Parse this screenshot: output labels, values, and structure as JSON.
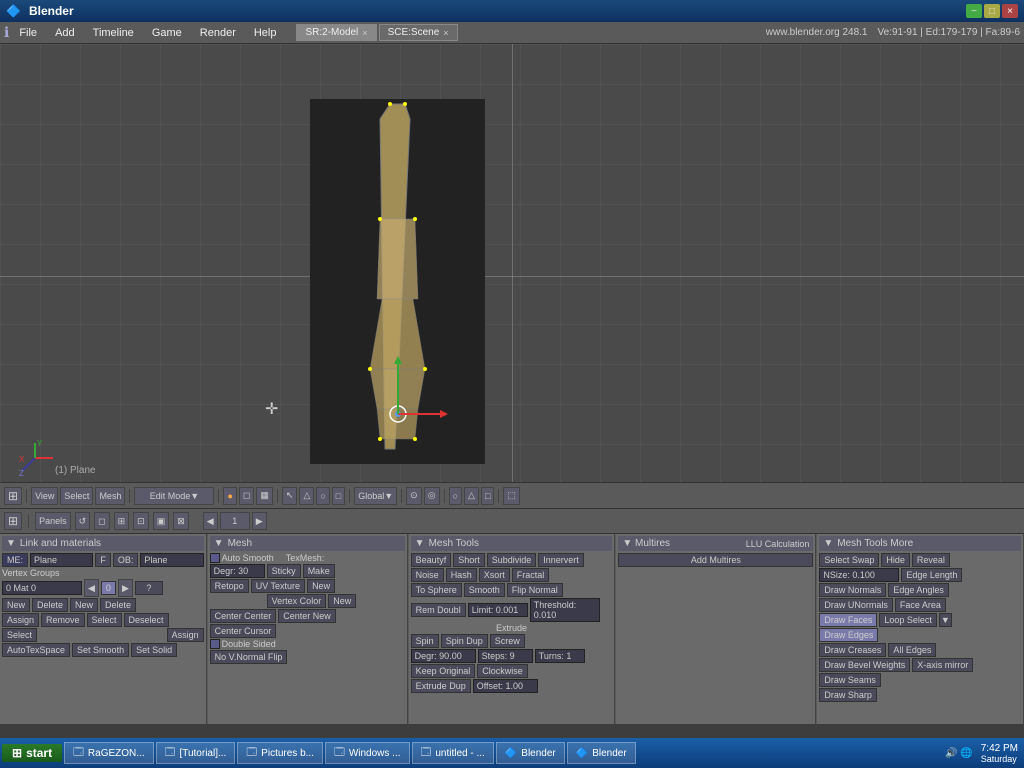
{
  "titlebar": {
    "title": "Blender",
    "min": "−",
    "max": "□",
    "close": "×"
  },
  "menubar": {
    "items": [
      "File",
      "Add",
      "Timeline",
      "Game",
      "Render",
      "Help"
    ],
    "tabs": [
      {
        "label": "SR:2-Model",
        "active": true
      },
      {
        "label": "SCE:Scene",
        "active": false
      }
    ],
    "website": "www.blender.org 248.1",
    "info": "Ve:91-91 | Ed:179-179 | Fa:89-6"
  },
  "viewport_toolbar": {
    "mode": "Edit Mode",
    "select_mode": "Global",
    "items": [
      "View",
      "Select",
      "Mesh"
    ]
  },
  "panels_toolbar": {
    "label": "Panels",
    "page": "1"
  },
  "object_label": "(1) Plane",
  "panel_link": {
    "header": "Link and materials",
    "me_label": "ME:",
    "me_value": "Plane",
    "f_label": "F",
    "ob_label": "OB:",
    "ob_value": "Plane",
    "vertex_groups": "Vertex Groups",
    "mat0": "0 Mat 0",
    "buttons": {
      "new": "New",
      "delete": "Delete",
      "assign": "Assign",
      "remove": "Remove",
      "select": "Select",
      "deselect": "Deselect",
      "set_smooth": "Set Smooth",
      "set_solid": "Set Solid",
      "autotexspace": "AutoTexSpace"
    }
  },
  "panel_mesh": {
    "header": "Mesh",
    "auto_smooth": "Auto Smooth",
    "degr": "Degr: 30",
    "retopo": "Retopo",
    "tex_mesh": "TexMesh:",
    "sticky": "Sticky",
    "uv_texture": "UV Texture",
    "vertex_color": "Vertex Color",
    "make": "Make",
    "new": "New",
    "center_center": "Center Center",
    "center_new": "Center New",
    "center_cursor": "Center Cursor",
    "double_sided": "Double Sided",
    "no_v_normal_flip": "No V.Normal Flip"
  },
  "panel_mesh_tools": {
    "header": "Mesh Tools",
    "buttons": {
      "beauty": "Beautyf",
      "short": "Short",
      "subdivide": "Subdivide",
      "innervert": "Innervert",
      "noise": "Noise",
      "hash": "Hash",
      "xsort": "Xsort",
      "fractal": "Fractal",
      "to_sphere": "To Sphere",
      "smooth": "Smooth",
      "flip_normal": "Flip Normal",
      "rem_doubl": "Rem Doubl",
      "limit": "Limit: 0.001",
      "threshold": "Threshold: 0.010",
      "extrude": "Extrude",
      "spin": "Spin",
      "spin_dup": "Spin Dup",
      "screw": "Screw",
      "degr": "Degr: 90.00",
      "steps": "Steps: 9",
      "turns": "Turns: 1",
      "keep_original": "Keep Original",
      "clockwise": "Clockwise",
      "extrude_dup": "Extrude Dup",
      "offset": "Offset: 1.00"
    }
  },
  "panel_multires": {
    "header": "Multires",
    "llu_calc": "LLU Calculation",
    "add_multires": "Add Multires"
  },
  "panel_mesh_tools_more": {
    "header": "Mesh Tools More",
    "buttons": {
      "select_swap": "Select Swap",
      "hide": "Hide",
      "reveal": "Reveal",
      "nsize": "NSize: 0.100",
      "edge_length": "Edge Length",
      "draw_normals": "Draw Normals",
      "edge_angles": "Edge Angles",
      "draw_unormals": "Draw UNormals",
      "face_area": "Face Area",
      "draw_faces": "Draw Faces",
      "loop_select": "Loop Select",
      "draw_edges": "Draw Edges",
      "draw_creases": "Draw Creases",
      "draw_bevel_weights": "Draw Bevel Weights",
      "all_edges": "All Edges",
      "draw_seams": "Draw Seams",
      "x_axis_mirror": "X-axis mirror",
      "draw_sharp": "Draw Sharp"
    }
  },
  "taskbar": {
    "start": "start",
    "items": [
      {
        "label": "RaGEZON...",
        "icon": "🗔"
      },
      {
        "label": "[Tutorial]...",
        "icon": "🗔"
      },
      {
        "label": "Pictures b...",
        "icon": "🗔"
      },
      {
        "label": "Windows ...",
        "icon": "🗔"
      },
      {
        "label": "untitled - ...",
        "icon": "🗔"
      },
      {
        "label": "Blender",
        "icon": "🔷"
      },
      {
        "label": "Blender",
        "icon": "🔷"
      }
    ],
    "time": "7:42 PM",
    "day": "Saturday"
  }
}
